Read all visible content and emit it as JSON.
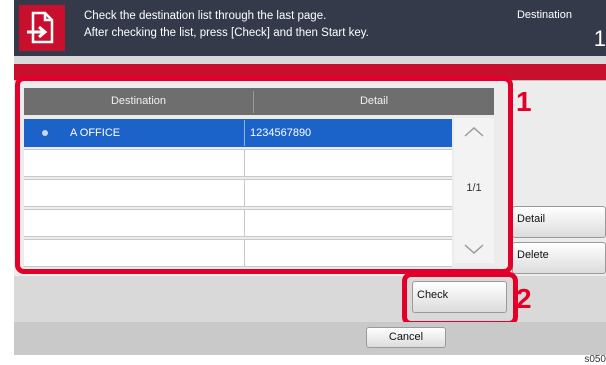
{
  "header": {
    "message_line1": "Check the destination list through the last page.",
    "message_line2": "After checking the list, press [Check] and then Start key.",
    "destination_label": "Destination",
    "destination_count": "1"
  },
  "table": {
    "columns": [
      "Destination",
      "Detail"
    ],
    "rows": [
      {
        "destination": "A OFFICE",
        "detail": "1234567890",
        "selected": true
      },
      {
        "destination": "",
        "detail": "",
        "selected": false
      },
      {
        "destination": "",
        "detail": "",
        "selected": false
      },
      {
        "destination": "",
        "detail": "",
        "selected": false
      },
      {
        "destination": "",
        "detail": "",
        "selected": false
      }
    ],
    "page_indicator": "1/1"
  },
  "buttons": {
    "detail": "Detail",
    "delete": "Delete",
    "check": "Check",
    "cancel": "Cancel"
  },
  "callouts": {
    "list": "1",
    "check": "2"
  },
  "image_tag": "s050",
  "colors": {
    "accent_red": "#c8102e",
    "selection_blue": "#1b63c8",
    "header_dark": "#343a4a"
  }
}
